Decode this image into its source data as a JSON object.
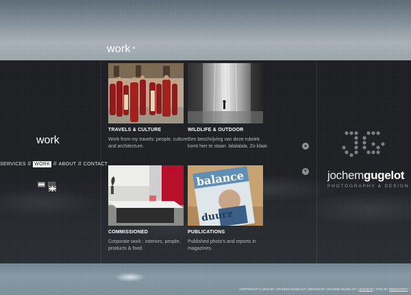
{
  "header": {
    "title": "work",
    "title_dot": "•"
  },
  "sidebar": {
    "section_title": "work",
    "nav": [
      {
        "label": "SERVICES",
        "active": false
      },
      {
        "label": "WORK",
        "active": true
      },
      {
        "label": "ABOUT",
        "active": false
      },
      {
        "label": "CONTACT",
        "active": false
      }
    ],
    "separator": "//",
    "languages": [
      "nl-flag-icon",
      "en-flag-icon"
    ]
  },
  "cards": [
    {
      "title": "TRAVELS & CULTURE",
      "description": "Work from my travels: people, culture and architecture."
    },
    {
      "title": "WILDLIFE & OUTDOOR",
      "description": "Een beschrijving van deze rubriek komt hier te staan. lalalalala. Zo klaar."
    },
    {
      "title": "COMMISSIONED",
      "description": "Corporate work : interiors, people, products & food."
    },
    {
      "title": "PUBLICATIONS",
      "description": "Published photo's and reports in magazines."
    }
  ],
  "scroll": {
    "up_icon": "arrow-up-icon",
    "down_icon": "arrow-down-icon",
    "up": "▲",
    "down": "▼"
  },
  "brand": {
    "first": "jochem",
    "last": "gugelot",
    "tagline": "PHOTOGRAPHY & DESIGN",
    "logo_icon": "jg-dot-logo-icon"
  },
  "footer": {
    "copyright": "COPYRIGHT © 2010 BY JOCHEM GUGELOT | DESIGN BY JOCHEM GUGELOT |",
    "sitemap": "SITEMAP",
    "site_by_prefix": "| SITE BY",
    "site_by": "WEBSCRIPT",
    "end": "|"
  },
  "colors": {
    "accent": "#ffffff",
    "band": "#1f2125",
    "sky": "#8a959f",
    "water": "#7f929d"
  }
}
